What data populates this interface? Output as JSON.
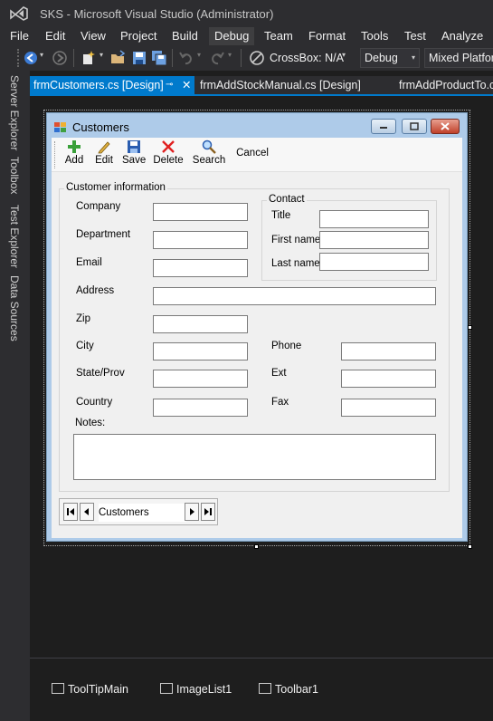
{
  "app": {
    "title": "SKS - Microsoft Visual Studio  (Administrator)"
  },
  "menu": {
    "items": [
      "File",
      "Edit",
      "View",
      "Project",
      "Build",
      "Debug",
      "Team",
      "Format",
      "Tools",
      "Test",
      "Analyze"
    ]
  },
  "toolbar": {
    "crossbox": "CrossBox: N/A",
    "config": "Debug",
    "platform": "Mixed Platforms"
  },
  "side_tabs": [
    "Server Explorer",
    "Toolbox",
    "Test Explorer",
    "Data Sources"
  ],
  "doc_tabs": [
    {
      "label": "frmCustomers.cs [Design]",
      "active": true
    },
    {
      "label": "frmAddStockManual.cs [Design]",
      "active": false
    },
    {
      "label": "frmAddProductTo.c",
      "active": false
    }
  ],
  "form": {
    "title": "Customers",
    "toolbar": [
      "Add",
      "Edit",
      "Save",
      "Delete",
      "Search",
      "Cancel"
    ],
    "customer_group": "Customer information",
    "contact_group": "Contact",
    "labels": {
      "company": "Company",
      "department": "Department",
      "email": "Email",
      "address": "Address",
      "zip": "Zip",
      "city": "City",
      "state": "State/Prov",
      "country": "Country",
      "notes": "Notes:",
      "title": "Title",
      "first_name": "First name",
      "last_name": "Last name",
      "phone": "Phone",
      "ext": "Ext",
      "fax": "Fax"
    },
    "navigator": {
      "label": "Customers"
    }
  },
  "tray": [
    "ToolTipMain",
    "ImageList1",
    "Toolbar1"
  ],
  "colors": {
    "accent": "#007acc",
    "chrome": "#2d2d30",
    "background": "#1e1e1e"
  }
}
